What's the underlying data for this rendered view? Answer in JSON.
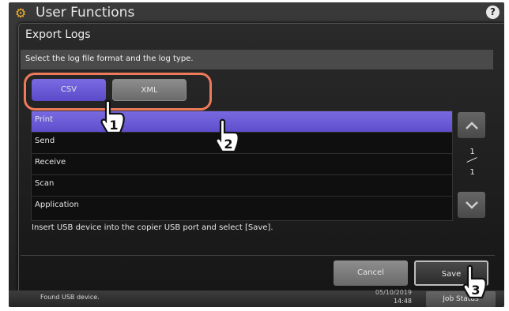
{
  "app": {
    "title": "User Functions",
    "help_label": "?"
  },
  "dialog": {
    "title": "Export Logs",
    "instruction": "Select the log file format and the log type.",
    "formats": [
      {
        "label": "CSV",
        "selected": true
      },
      {
        "label": "XML",
        "selected": false
      }
    ],
    "log_types": [
      {
        "label": "Print",
        "selected": true
      },
      {
        "label": "Send"
      },
      {
        "label": "Receive"
      },
      {
        "label": "Scan"
      },
      {
        "label": "Application"
      }
    ],
    "page": {
      "current": "1",
      "total": "1"
    },
    "note": "Insert USB device into the copier USB port and select [Save].",
    "cancel_label": "Cancel",
    "save_label": "Save"
  },
  "status": {
    "message": "Found USB device.",
    "date": "05/10/2019",
    "time": "14:48",
    "job_status_label": "Job Status"
  },
  "callouts": [
    "1",
    "2",
    "3"
  ],
  "colors": {
    "accent": "#6a5ad8",
    "highlight_ring": "#ef7a5a",
    "background": "#1f1f1f"
  }
}
